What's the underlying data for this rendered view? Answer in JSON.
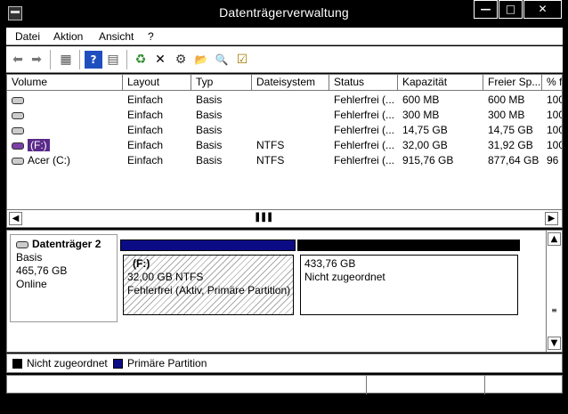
{
  "window": {
    "title": "Datenträgerverwaltung",
    "min": "—",
    "max": "□",
    "close": "✕"
  },
  "menu": [
    "Datei",
    "Aktion",
    "Ansicht",
    "?"
  ],
  "toolbar": [
    {
      "name": "back-arrow-icon",
      "glyph": "⬅"
    },
    {
      "name": "forward-arrow-icon",
      "glyph": "➡"
    },
    {
      "name": "console-tree-icon",
      "glyph": "▦"
    },
    {
      "name": "help-icon",
      "glyph": "?"
    },
    {
      "name": "properties-icon",
      "glyph": "▤"
    },
    {
      "name": "refresh-icon",
      "glyph": "♻"
    },
    {
      "name": "delete-icon",
      "glyph": "✕"
    },
    {
      "name": "settings-icon",
      "glyph": "⚙"
    },
    {
      "name": "open-folder-icon",
      "glyph": "📂"
    },
    {
      "name": "search-icon",
      "glyph": "🔍"
    },
    {
      "name": "checklist-icon",
      "glyph": "☑"
    }
  ],
  "columns": [
    "Volume",
    "Layout",
    "Typ",
    "Dateisystem",
    "Status",
    "Kapazität",
    "Freier Sp...",
    "% f"
  ],
  "volumes": [
    {
      "name": "",
      "layout": "Einfach",
      "typ": "Basis",
      "fs": "",
      "status": "Fehlerfrei (...",
      "kap": "600 MB",
      "frei": "600 MB",
      "pct": "100"
    },
    {
      "name": "",
      "layout": "Einfach",
      "typ": "Basis",
      "fs": "",
      "status": "Fehlerfrei (...",
      "kap": "300 MB",
      "frei": "300 MB",
      "pct": "100"
    },
    {
      "name": "",
      "layout": "Einfach",
      "typ": "Basis",
      "fs": "",
      "status": "Fehlerfrei (...",
      "kap": "14,75 GB",
      "frei": "14,75 GB",
      "pct": "100"
    },
    {
      "name": "(F:)",
      "layout": "Einfach",
      "typ": "Basis",
      "fs": "NTFS",
      "status": "Fehlerfrei (...",
      "kap": "32,00 GB",
      "frei": "31,92 GB",
      "pct": "100"
    },
    {
      "name": "Acer (C:)",
      "layout": "Einfach",
      "typ": "Basis",
      "fs": "NTFS",
      "status": "Fehlerfrei (...",
      "kap": "915,76 GB",
      "frei": "877,64 GB",
      "pct": "96"
    }
  ],
  "disk": {
    "name": "Datenträger 2",
    "type": "Basis",
    "size": "465,76 GB",
    "state": "Online"
  },
  "partitions": [
    {
      "label": "(F:)",
      "size": "32,00 GB NTFS",
      "status": "Fehlerfrei (Aktiv, Primäre Partition)"
    },
    {
      "label": "",
      "size": "433,76 GB",
      "status": "Nicht zugeordnet"
    }
  ],
  "legend": [
    {
      "label": "Nicht zugeordnet",
      "color": "#000000"
    },
    {
      "label": "Primäre Partition",
      "color": "#0b0b86"
    }
  ]
}
